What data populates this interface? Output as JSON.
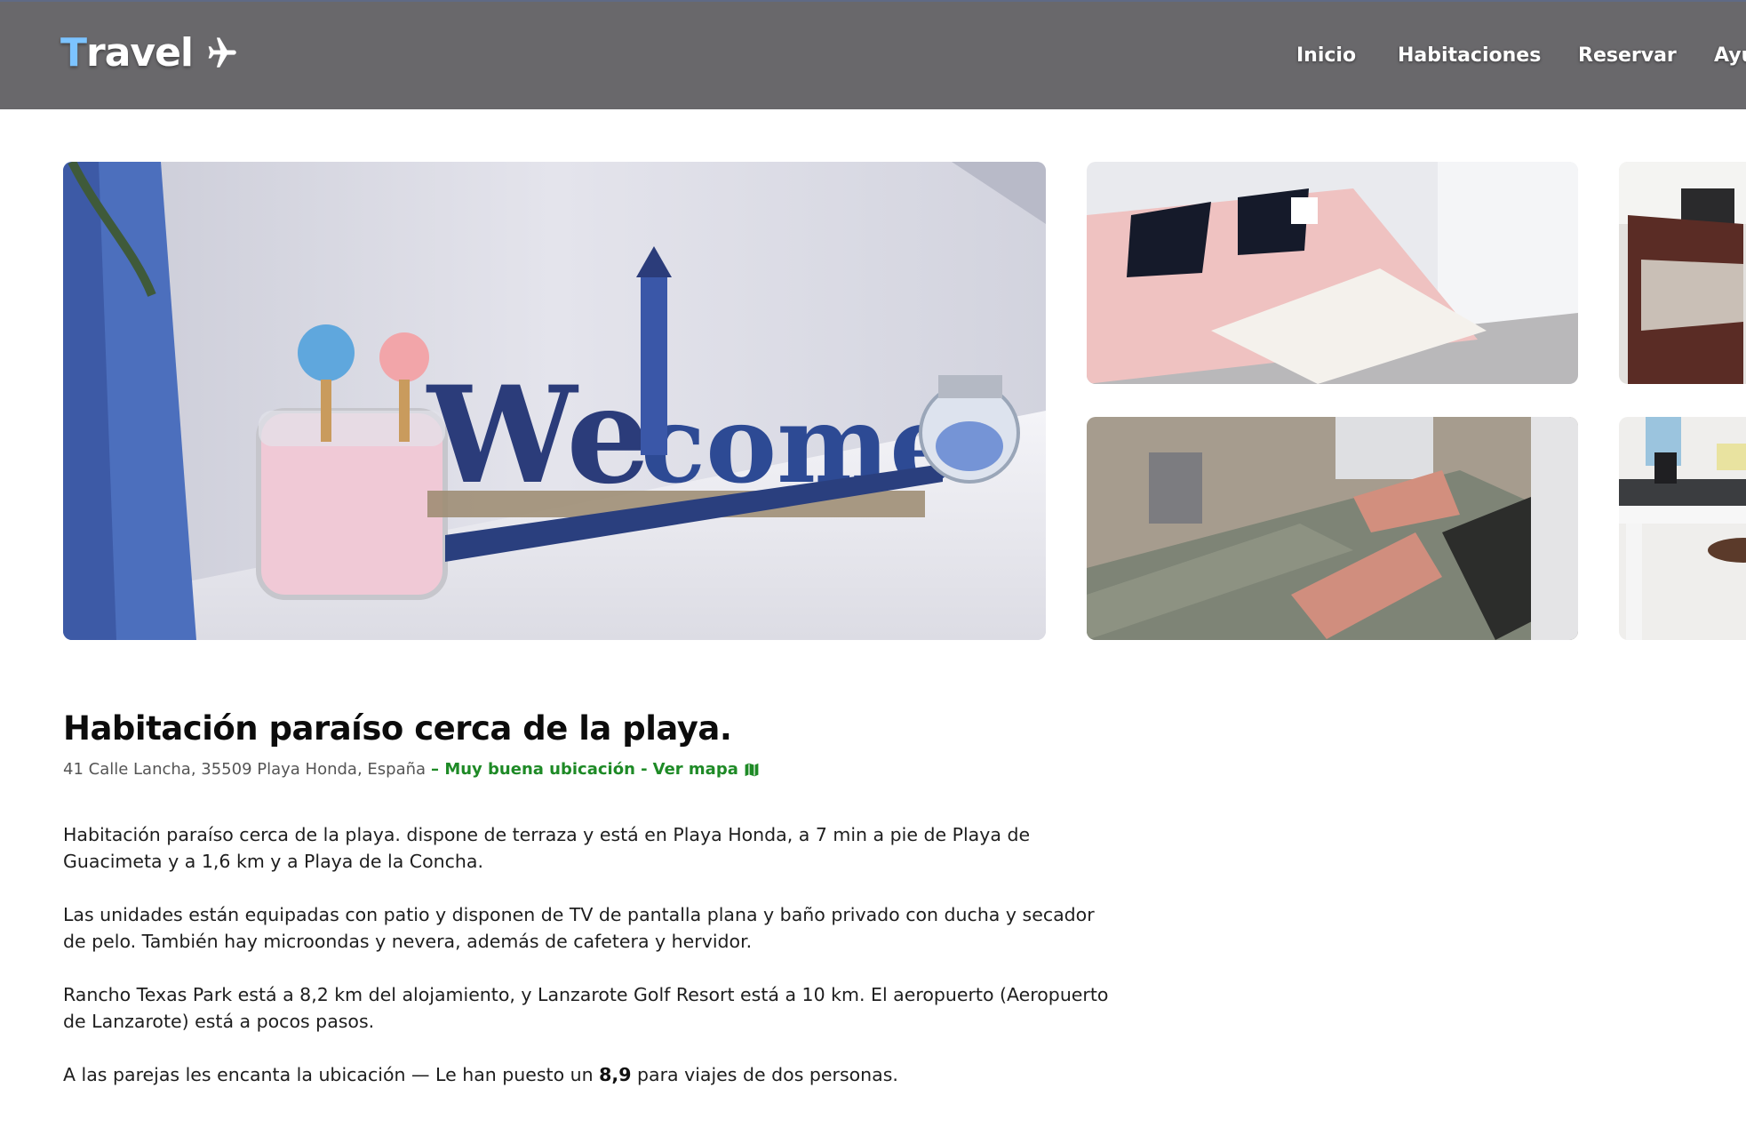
{
  "brand": {
    "first_letter": "T",
    "rest": "ravel",
    "icon": "airplane-icon"
  },
  "nav": {
    "items": [
      {
        "label": "Inicio"
      },
      {
        "label": "Habitaciones"
      },
      {
        "label": "Reservar"
      },
      {
        "label": "Ayu"
      }
    ]
  },
  "gallery": {
    "photos": [
      {
        "name": "welcome-sign-photo"
      },
      {
        "name": "pink-bed-photo"
      },
      {
        "name": "terrace-chairs-photo"
      },
      {
        "name": "grey-bed-photo"
      },
      {
        "name": "desk-photo"
      }
    ]
  },
  "listing": {
    "title": "Habitación paraíso cerca de la playa.",
    "address": "41 Calle Lancha, 35509 Playa Honda, España",
    "location_rating": "– Muy buena ubicación -",
    "map_link": "Ver mapa",
    "paragraphs": [
      "Habitación paraíso cerca de la playa. dispone de terraza y está en Playa Honda, a 7 min a pie de Playa de Guacimeta y a 1,6 km y a Playa de la Concha.",
      "Las unidades están equipadas con patio y disponen de TV de pantalla plana y baño privado con ducha y secador de pelo. También hay microondas y nevera, además de cafetera y hervidor.",
      "Rancho Texas Park está a 8,2 km del alojamiento, y Lanzarote Golf Resort está a 10 km. El aeropuerto (Aeropuerto de Lanzarote) está a pocos pasos."
    ],
    "couples": {
      "before": "A las parejas les encanta la ubicación — Le han puesto un ",
      "score": "8,9",
      "after": " para viajes de dos personas."
    }
  },
  "colors": {
    "navbar_bg": "#69686b",
    "logo_accent": "#7cc3ff",
    "location_green": "#1e8a26"
  }
}
